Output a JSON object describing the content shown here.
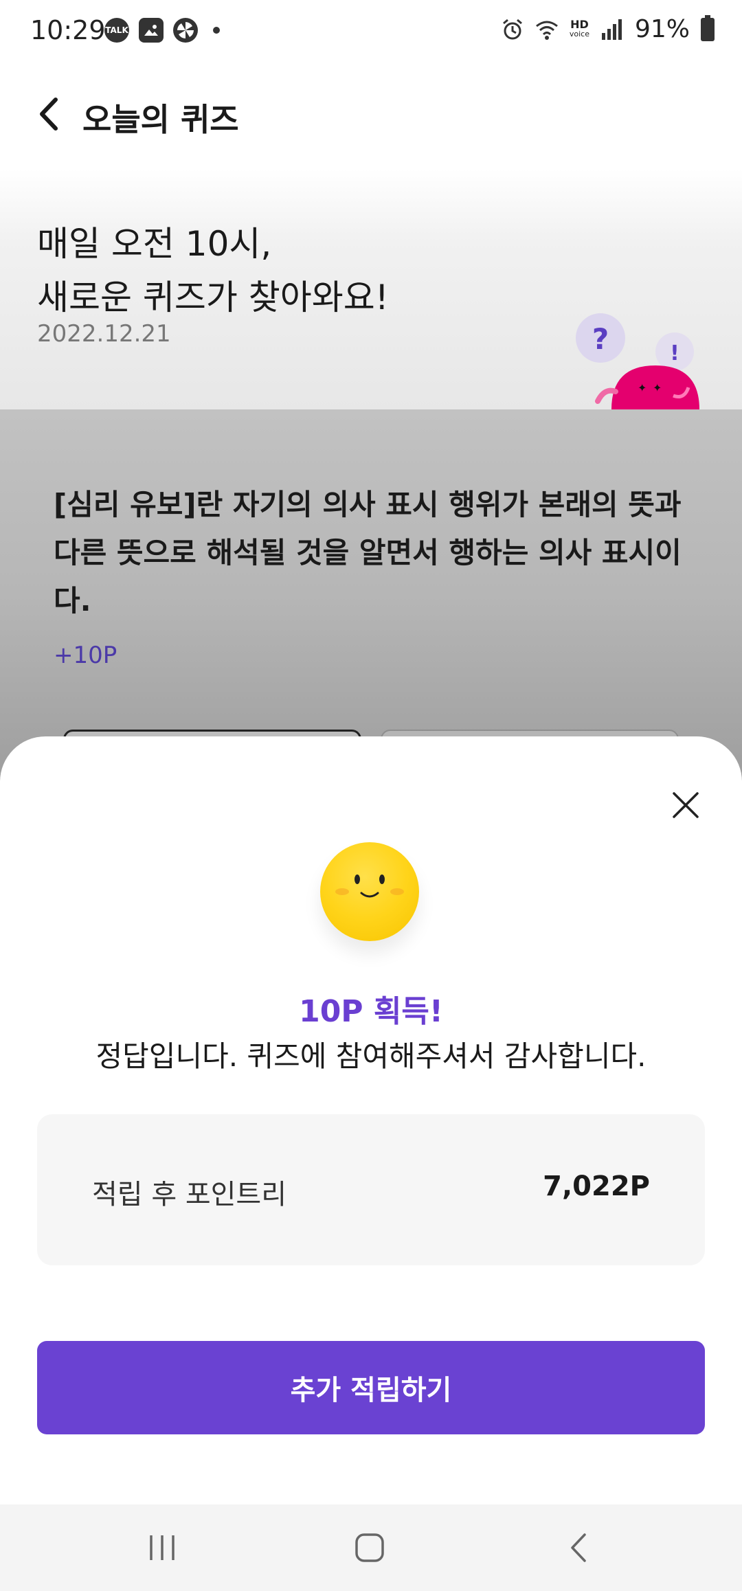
{
  "status_bar": {
    "time": "10:29",
    "notification_icons": [
      "talk-icon",
      "gallery-icon",
      "pinwheel-icon",
      "dot-icon"
    ],
    "system_icons": [
      "alarm-icon",
      "wifi-icon",
      "hd-voice-icon",
      "signal-icon",
      "battery-icon"
    ],
    "hd_label": "HD",
    "voice_label": "voice",
    "battery": "91%"
  },
  "header": {
    "title": "오늘의 퀴즈"
  },
  "hero": {
    "title_line1": "매일 오전 10시,",
    "title_line2": "새로운 퀴즈가 찾아와요!",
    "date": "2022.12.21",
    "bubble_question": "?",
    "bubble_exclaim": "!"
  },
  "quiz": {
    "question": "[심리 유보]란 자기의 의사 표시 행위가 본래의 뜻과 다른 뜻으로 해석될 것을 알면서 행하는 의사 표시이다.",
    "points": "+10P"
  },
  "result_sheet": {
    "title": "10P 획득!",
    "message": "정답입니다. 퀴즈에 참여해주셔서 감사합니다.",
    "points_label": "적립 후 포인트리",
    "points_value": "7,022P",
    "cta_label": "추가 적립하기"
  },
  "colors": {
    "accent": "#6a42d2",
    "accent_text": "#6a3fd1",
    "mascot": "#e4006e",
    "smiley": "#ffd41a"
  }
}
